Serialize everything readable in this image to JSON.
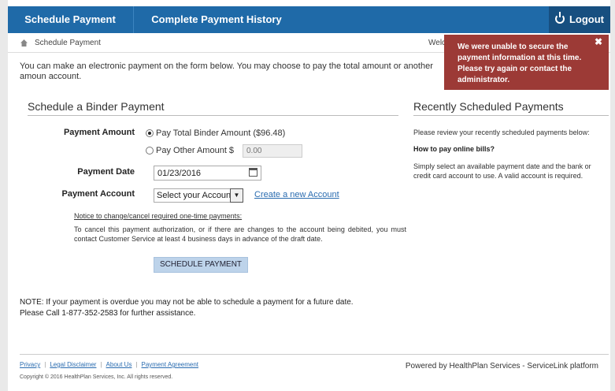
{
  "nav": {
    "schedule": "Schedule Payment",
    "history": "Complete Payment History",
    "logout": "Logout"
  },
  "breadcrumb": {
    "current": "Schedule Payment",
    "welcome": "Welc"
  },
  "intro": "You can make an electronic payment on the form below. You may choose to pay the total amount or another amoun account.",
  "form": {
    "title": "Schedule a Binder Payment",
    "amount_label": "Payment Amount",
    "pay_total": "Pay Total Binder Amount ($96.48)",
    "pay_other": "Pay Other Amount $",
    "other_amount_placeholder": "0.00",
    "date_label": "Payment Date",
    "date_value": "01/23/2016",
    "account_label": "Payment Account",
    "account_selected": "Select your Account",
    "create_account": "Create a new Account",
    "notice_title": "Notice to change/cancel required one-time payments:",
    "notice_body": "To cancel this payment authorization, or if there are changes to the account being debited, you must contact Customer Service at least 4 business days in advance of the draft date.",
    "submit": "SCHEDULE PAYMENT"
  },
  "note": {
    "line1": "NOTE: If your payment is overdue you may not be able to schedule a payment for a future date.",
    "line2": "Please Call 1-877-352-2583 for further assistance."
  },
  "recent": {
    "title": "Recently Scheduled Payments",
    "review": "Please review your recently scheduled payments below:",
    "howto_title": "How to pay online bills?",
    "howto_body": "Simply select an available payment date and the bank or credit card account to use. A valid account is required."
  },
  "footer": {
    "privacy": "Privacy",
    "legal": "Legal Disclaimer",
    "about": "About Us",
    "agreement": "Payment Agreement",
    "copyright": "Copyright © 2016 HealthPlan Services, Inc. All rights reserved.",
    "powered": "Powered by HealthPlan Services - ServiceLink platform"
  },
  "toast": {
    "message": "We were unable to secure the payment information at this time. Please try again or contact the administrator.",
    "close": "✖"
  },
  "icons": {
    "logout": "power-icon",
    "home": "home-icon",
    "calendar": "calendar-icon",
    "close": "close-icon"
  },
  "colors": {
    "nav_bg": "#1f6aa8",
    "logout_bg": "#174f80",
    "toast_bg": "#9c3a36",
    "link": "#2a6cb0",
    "button_bg": "#bdd3ea"
  }
}
